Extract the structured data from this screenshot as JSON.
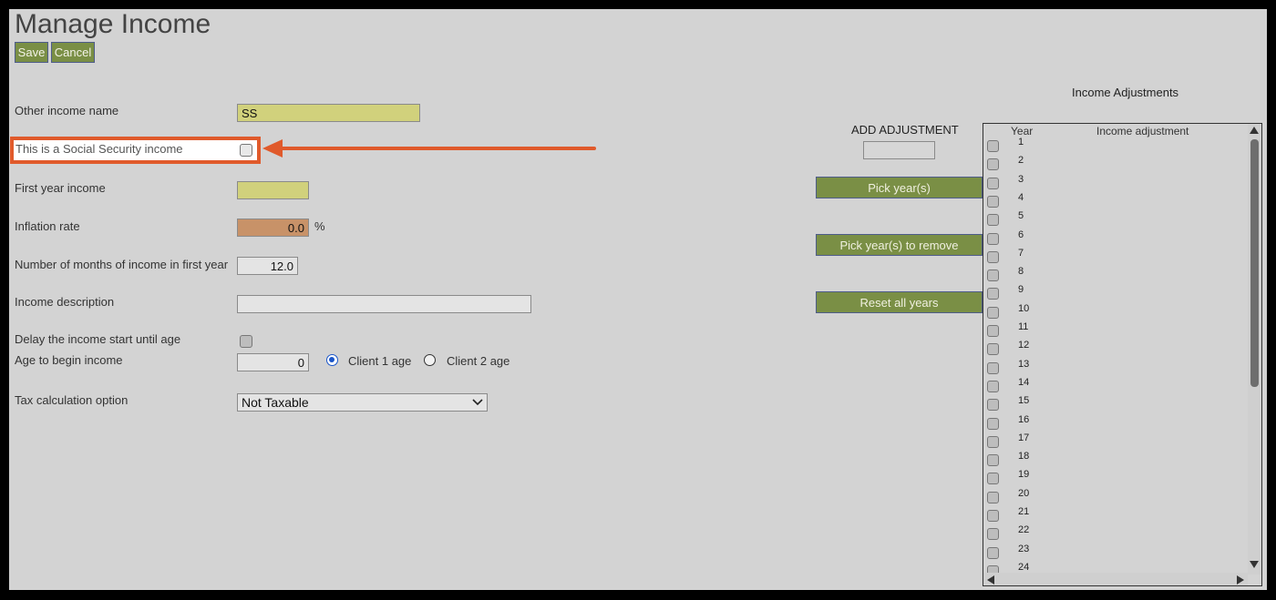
{
  "page": {
    "title": "Manage Income"
  },
  "toolbar": {
    "save_label": "Save",
    "cancel_label": "Cancel"
  },
  "form": {
    "other_income_name": {
      "label": "Other income name",
      "value": "SS"
    },
    "social_security": {
      "label": "This is a Social Security income",
      "checked": false
    },
    "first_year_income": {
      "label": "First year income",
      "value": ""
    },
    "inflation_rate": {
      "label": "Inflation rate",
      "value": "0.0",
      "unit": "%"
    },
    "months_first_year": {
      "label": "Number of months of income in first year",
      "value": "12.0"
    },
    "income_description": {
      "label": "Income description",
      "value": ""
    },
    "delay_start": {
      "label": "Delay the income start until age",
      "checked": false
    },
    "age_to_begin": {
      "label": "Age to begin income",
      "value": "0"
    },
    "age_option": {
      "client1": "Client 1 age",
      "client2": "Client 2 age",
      "selected": "client1"
    },
    "tax_option": {
      "label": "Tax calculation option",
      "value": "Not Taxable"
    }
  },
  "adjustments": {
    "panel_title": "Income Adjustments",
    "add_label": "ADD ADJUSTMENT",
    "add_value": "",
    "pick_years_label": "Pick year(s)",
    "pick_remove_label": "Pick year(s) to remove",
    "reset_label": "Reset all years",
    "col_year": "Year",
    "col_adjustment": "Income adjustment",
    "years": [
      "1",
      "2",
      "3",
      "4",
      "5",
      "6",
      "7",
      "8",
      "9",
      "10",
      "11",
      "12",
      "13",
      "14",
      "15",
      "16",
      "17",
      "18",
      "19",
      "20",
      "21",
      "22",
      "23",
      "24"
    ]
  },
  "colors": {
    "button_green": "#7a8f45",
    "field_yellow": "#d1d17c",
    "field_orange": "#c89268",
    "annotation_red": "#e05a2b",
    "radio_blue": "#1a56c9"
  },
  "icons": {
    "dropdown": "chevron-down-icon",
    "scroll_up": "triangle-up-icon",
    "scroll_down": "triangle-down-icon",
    "scroll_left": "triangle-left-icon",
    "scroll_right": "triangle-right-icon",
    "annotation": "arrow-left-icon"
  }
}
